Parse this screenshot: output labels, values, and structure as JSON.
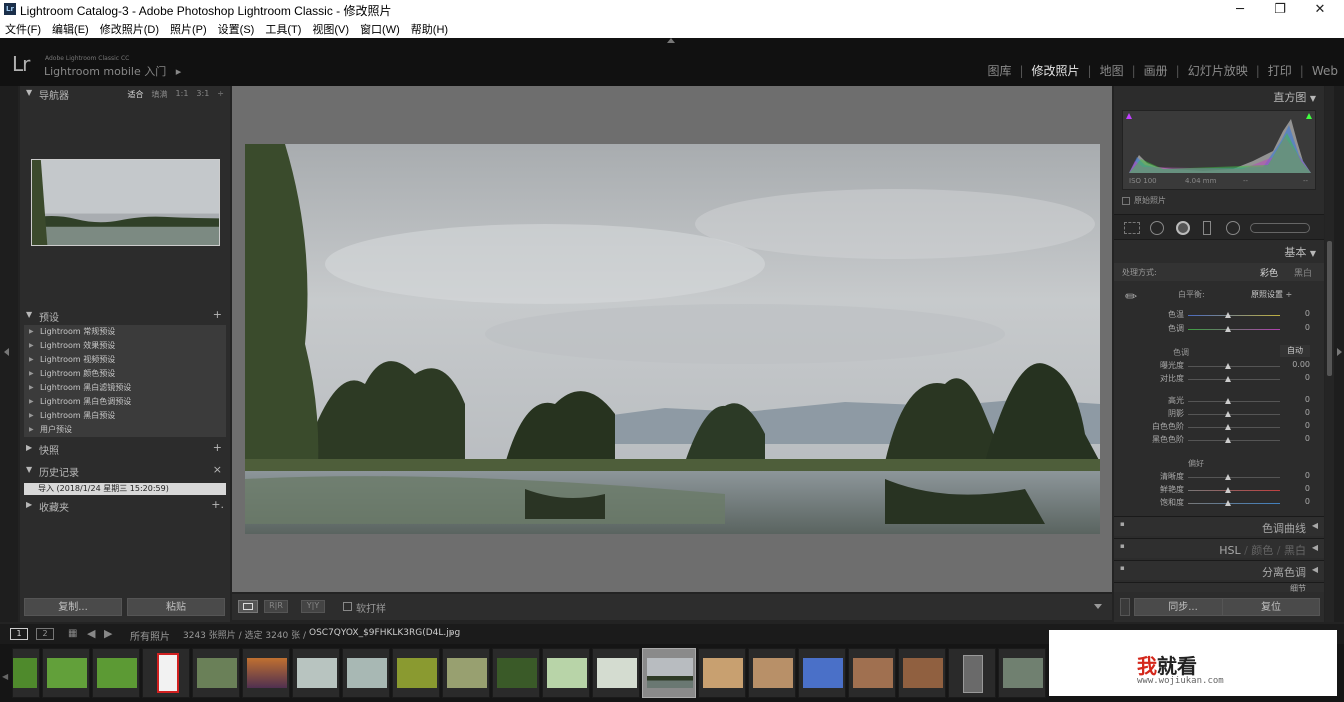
{
  "window": {
    "title": "Lightroom Catalog-3 - Adobe Photoshop Lightroom Classic - 修改照片",
    "lr_badge": "Lr",
    "minimize": "─",
    "maximize": "❐",
    "close": "✕"
  },
  "menu": [
    "文件(F)",
    "编辑(E)",
    "修改照片(D)",
    "照片(P)",
    "设置(S)",
    "工具(T)",
    "视图(V)",
    "窗口(W)",
    "帮助(H)"
  ],
  "identity": {
    "logo": "Lr",
    "app_small": "Adobe Lightroom Classic CC",
    "app_main": "Lightroom mobile 入门",
    "arrow": "▸"
  },
  "modules": [
    "图库",
    "修改照片",
    "地图",
    "画册",
    "幻灯片放映",
    "打印",
    "Web"
  ],
  "left": {
    "navigator": {
      "title": "导航器",
      "zoom": [
        "适合",
        "填满",
        "1:1",
        "3:1"
      ],
      "zoom_more": "÷"
    },
    "presets": {
      "title": "预设",
      "add": "+",
      "items": [
        "Lightroom 常规预设",
        "Lightroom 效果预设",
        "Lightroom 视频预设",
        "Lightroom 颜色预设",
        "Lightroom 黑白滤镜预设",
        "Lightroom 黑白色调预设",
        "Lightroom 黑白预设",
        "用户预设"
      ]
    },
    "snapshots": {
      "title": "快照",
      "add": "+"
    },
    "history": {
      "title": "历史记录",
      "clear": "×",
      "entry": "导入 (2018/1/24 星期三 15:20:59)"
    },
    "collections": {
      "title": "收藏夹",
      "add": "+."
    },
    "copy": "复制...",
    "paste": "粘贴"
  },
  "toolbar": {
    "softproof": "软打样"
  },
  "right": {
    "histogram": {
      "title": "直方图",
      "iso": "ISO 100",
      "focal": "4.04 mm",
      "a": "--",
      "b": "--",
      "original": "原始照片"
    },
    "basic": {
      "title": "基本",
      "treatment": "处理方式:",
      "color": "彩色",
      "bw": "黑白",
      "wb": "白平衡:",
      "wb_value": "原照设置 ÷",
      "temp": {
        "label": "色温",
        "value": "0"
      },
      "tint": {
        "label": "色调",
        "value": "0"
      },
      "tone_title": "色调",
      "auto": "自动",
      "exposure": {
        "label": "曝光度",
        "value": "0.00"
      },
      "contrast": {
        "label": "对比度",
        "value": "0"
      },
      "highlights": {
        "label": "高光",
        "value": "0"
      },
      "shadows": {
        "label": "阴影",
        "value": "0"
      },
      "whites": {
        "label": "白色色阶",
        "value": "0"
      },
      "blacks": {
        "label": "黑色色阶",
        "value": "0"
      },
      "presence_title": "偏好",
      "clarity": {
        "label": "清晰度",
        "value": "0"
      },
      "vibrance": {
        "label": "鲜艳度",
        "value": "0"
      },
      "saturation": {
        "label": "饱和度",
        "value": "0"
      }
    },
    "tone_curve": "色调曲线",
    "hsl": "HSL",
    "hsl_color": "颜色",
    "hsl_bw": "黑白",
    "split": "分离色调",
    "detail": "细节",
    "sync": "同步...",
    "reset": "复位"
  },
  "filmbar": {
    "page1": "1",
    "page2": "2",
    "source": "所有照片",
    "count": "3243 张照片 / 选定 3240 张 /",
    "filename": "OSC7QYOX_$9FHKLK3RG(D4L.jpg"
  },
  "watermark": {
    "brand_red": "我",
    "brand_rest": "就看",
    "url": "www.wojiukan.com"
  }
}
